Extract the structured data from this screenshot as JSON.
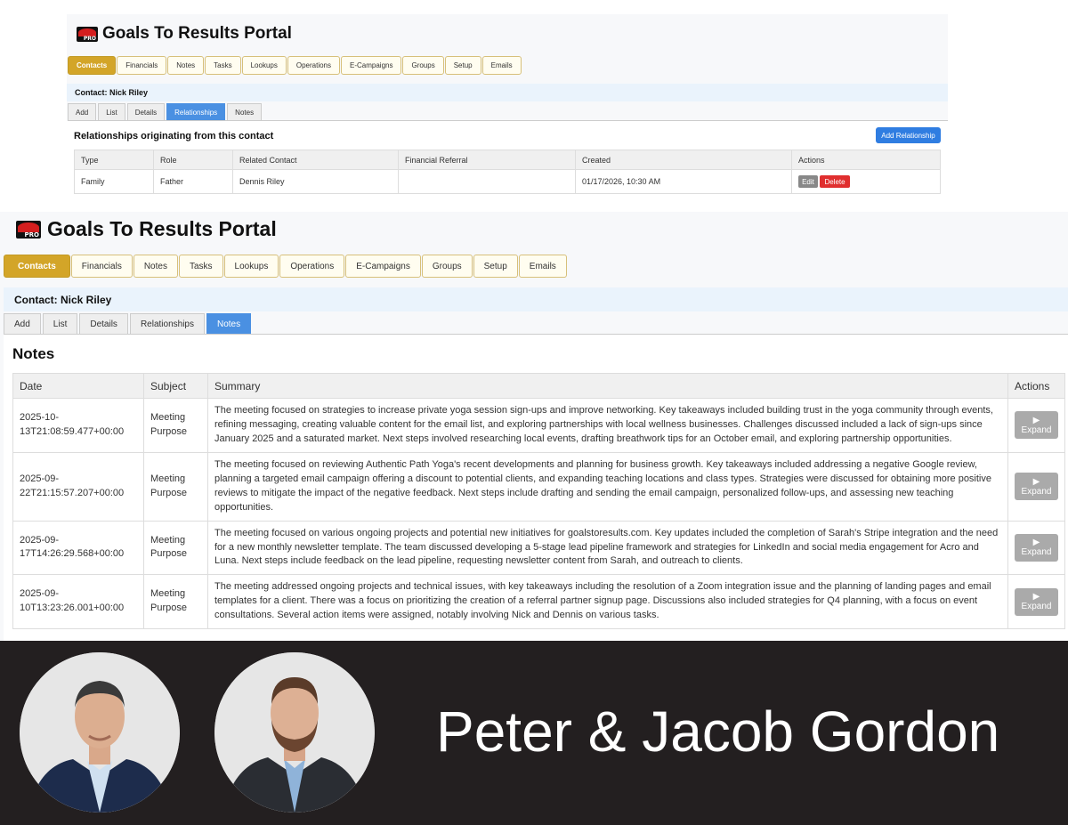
{
  "top_portal": {
    "app_title": "Goals To Results Portal",
    "logo_text": "PRO",
    "menu": [
      "Contacts",
      "Financials",
      "Notes",
      "Tasks",
      "Lookups",
      "Operations",
      "E-Campaigns",
      "Groups",
      "Setup",
      "Emails"
    ],
    "active_menu": "Contacts",
    "contact_label": "Contact: Nick Riley",
    "subtabs": [
      "Add",
      "List",
      "Details",
      "Relationships",
      "Notes"
    ],
    "active_subtab": "Relationships",
    "section_title": "Relationships originating from this contact",
    "add_button": "Add Relationship",
    "table": {
      "headers": [
        "Type",
        "Role",
        "Related Contact",
        "Financial Referral",
        "Created",
        "Actions"
      ],
      "rows": [
        {
          "type": "Family",
          "role": "Father",
          "related_contact": "Dennis Riley",
          "financial_referral": "",
          "created": "01/17/2026, 10:30 AM"
        }
      ],
      "edit_label": "Edit",
      "delete_label": "Delete"
    }
  },
  "bottom_portal": {
    "app_title": "Goals To Results Portal",
    "logo_text": "PRO",
    "menu": [
      "Contacts",
      "Financials",
      "Notes",
      "Tasks",
      "Lookups",
      "Operations",
      "E-Campaigns",
      "Groups",
      "Setup",
      "Emails"
    ],
    "active_menu": "Contacts",
    "contact_label": "Contact: Nick Riley",
    "subtabs": [
      "Add",
      "List",
      "Details",
      "Relationships",
      "Notes"
    ],
    "active_subtab": "Notes",
    "section_title": "Notes",
    "table": {
      "headers": [
        "Date",
        "Subject",
        "Summary",
        "Actions"
      ],
      "rows": [
        {
          "date_line1": "2025-10-",
          "date_line2": "13T21:08:59.477+00:00",
          "subject_line1": "Meeting",
          "subject_line2": "Purpose",
          "summary": "The meeting focused on strategies to increase private yoga session sign-ups and improve networking. Key takeaways included building trust in the yoga community through events, refining messaging, creating valuable content for the email list, and exploring partnerships with local wellness businesses. Challenges discussed included a lack of sign-ups since January 2025 and a saturated market. Next steps involved researching local events, drafting breathwork tips for an October email, and exploring partnership opportunities."
        },
        {
          "date_line1": "2025-09-",
          "date_line2": "22T21:15:57.207+00:00",
          "subject_line1": "Meeting",
          "subject_line2": "Purpose",
          "summary": "The meeting focused on reviewing Authentic Path Yoga's recent developments and planning for business growth. Key takeaways included addressing a negative Google review, planning a targeted email campaign offering a discount to potential clients, and expanding teaching locations and class types. Strategies were discussed for obtaining more positive reviews to mitigate the impact of the negative feedback. Next steps include drafting and sending the email campaign, personalized follow-ups, and assessing new teaching opportunities."
        },
        {
          "date_line1": "2025-09-",
          "date_line2": "17T14:26:29.568+00:00",
          "subject_line1": "Meeting",
          "subject_line2": "Purpose",
          "summary": "The meeting focused on various ongoing projects and potential new initiatives for goalstoresults.com. Key updates included the completion of Sarah's Stripe integration and the need for a new monthly newsletter template. The team discussed developing a 5-stage lead pipeline framework and strategies for LinkedIn and social media engagement for Acro and Luna. Next steps include feedback on the lead pipeline, requesting newsletter content from Sarah, and outreach to clients."
        },
        {
          "date_line1": "2025-09-",
          "date_line2": "10T13:23:26.001+00:00",
          "subject_line1": "Meeting",
          "subject_line2": "Purpose",
          "summary": "The meeting addressed ongoing projects and technical issues, with key takeaways including the resolution of a Zoom integration issue and the planning of landing pages and email templates for a client. There was a focus on prioritizing the creation of a referral partner signup page. Discussions also included strategies for Q4 planning, with a focus on event consultations. Several action items were assigned, notably involving Nick and Dennis on various tasks."
        }
      ],
      "expand_icon": "▶",
      "expand_label": "Expand"
    }
  },
  "banner": {
    "names": "Peter & Jacob Gordon"
  },
  "colors": {
    "active_menu": "#d3a528",
    "active_subtab": "#4a90e2",
    "primary_button": "#2f7de1",
    "delete_button": "#e02f2f",
    "banner_bg": "#231f20"
  }
}
